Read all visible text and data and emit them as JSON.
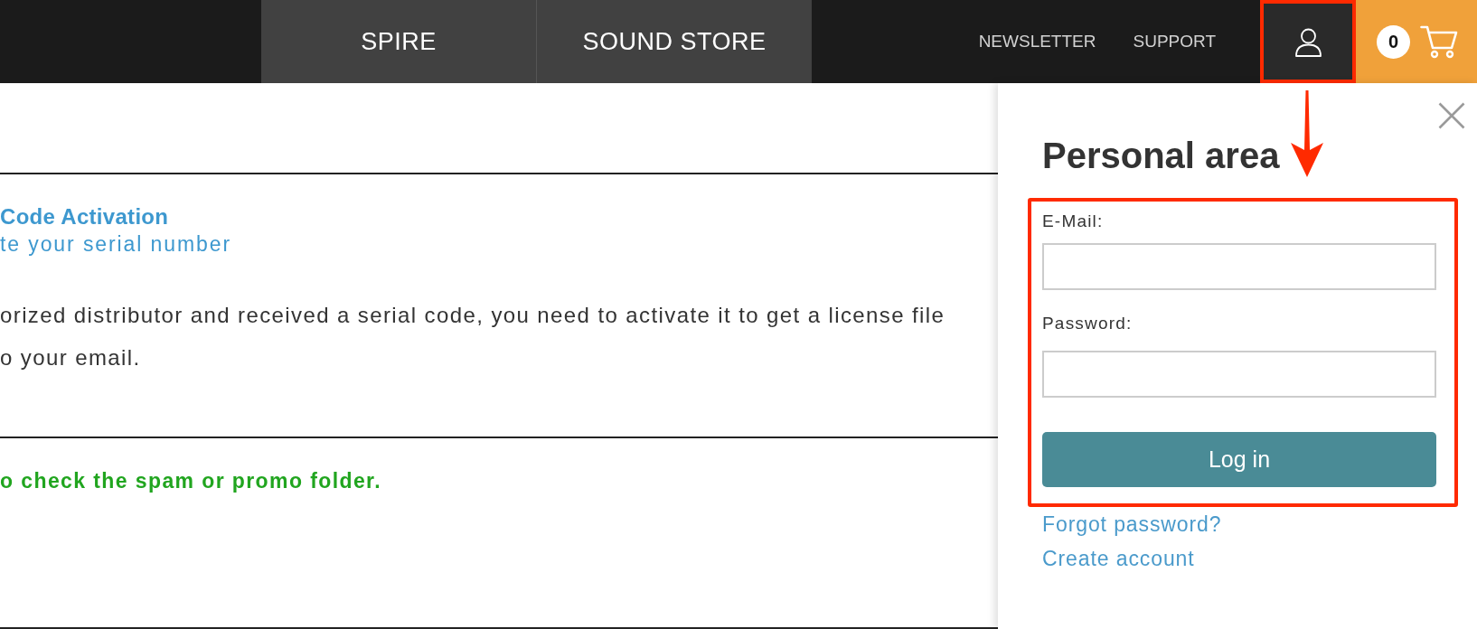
{
  "header": {
    "tabs": [
      {
        "label": "SPIRE"
      },
      {
        "label": "SOUND STORE"
      }
    ],
    "links": [
      {
        "label": "NEWSLETTER"
      },
      {
        "label": "SUPPORT"
      }
    ],
    "account": {
      "highlighted": true
    },
    "cart": {
      "count": "0"
    }
  },
  "content": {
    "sections": [
      {
        "kind": "activation",
        "title": "Code Activation",
        "subtitle": "te your serial number",
        "body": "orized distributor and received a serial code, you need to activate it to get a license file\no your email."
      },
      {
        "kind": "notice",
        "body": "o check the spam or promo folder."
      }
    ]
  },
  "panel": {
    "title": "Personal area",
    "arrow": true,
    "form": {
      "highlighted": true,
      "fields": [
        {
          "label": "E-Mail:"
        },
        {
          "label": "Password:"
        }
      ],
      "submit": "Log in"
    },
    "links": [
      "Forgot password?",
      "Create account"
    ]
  }
}
